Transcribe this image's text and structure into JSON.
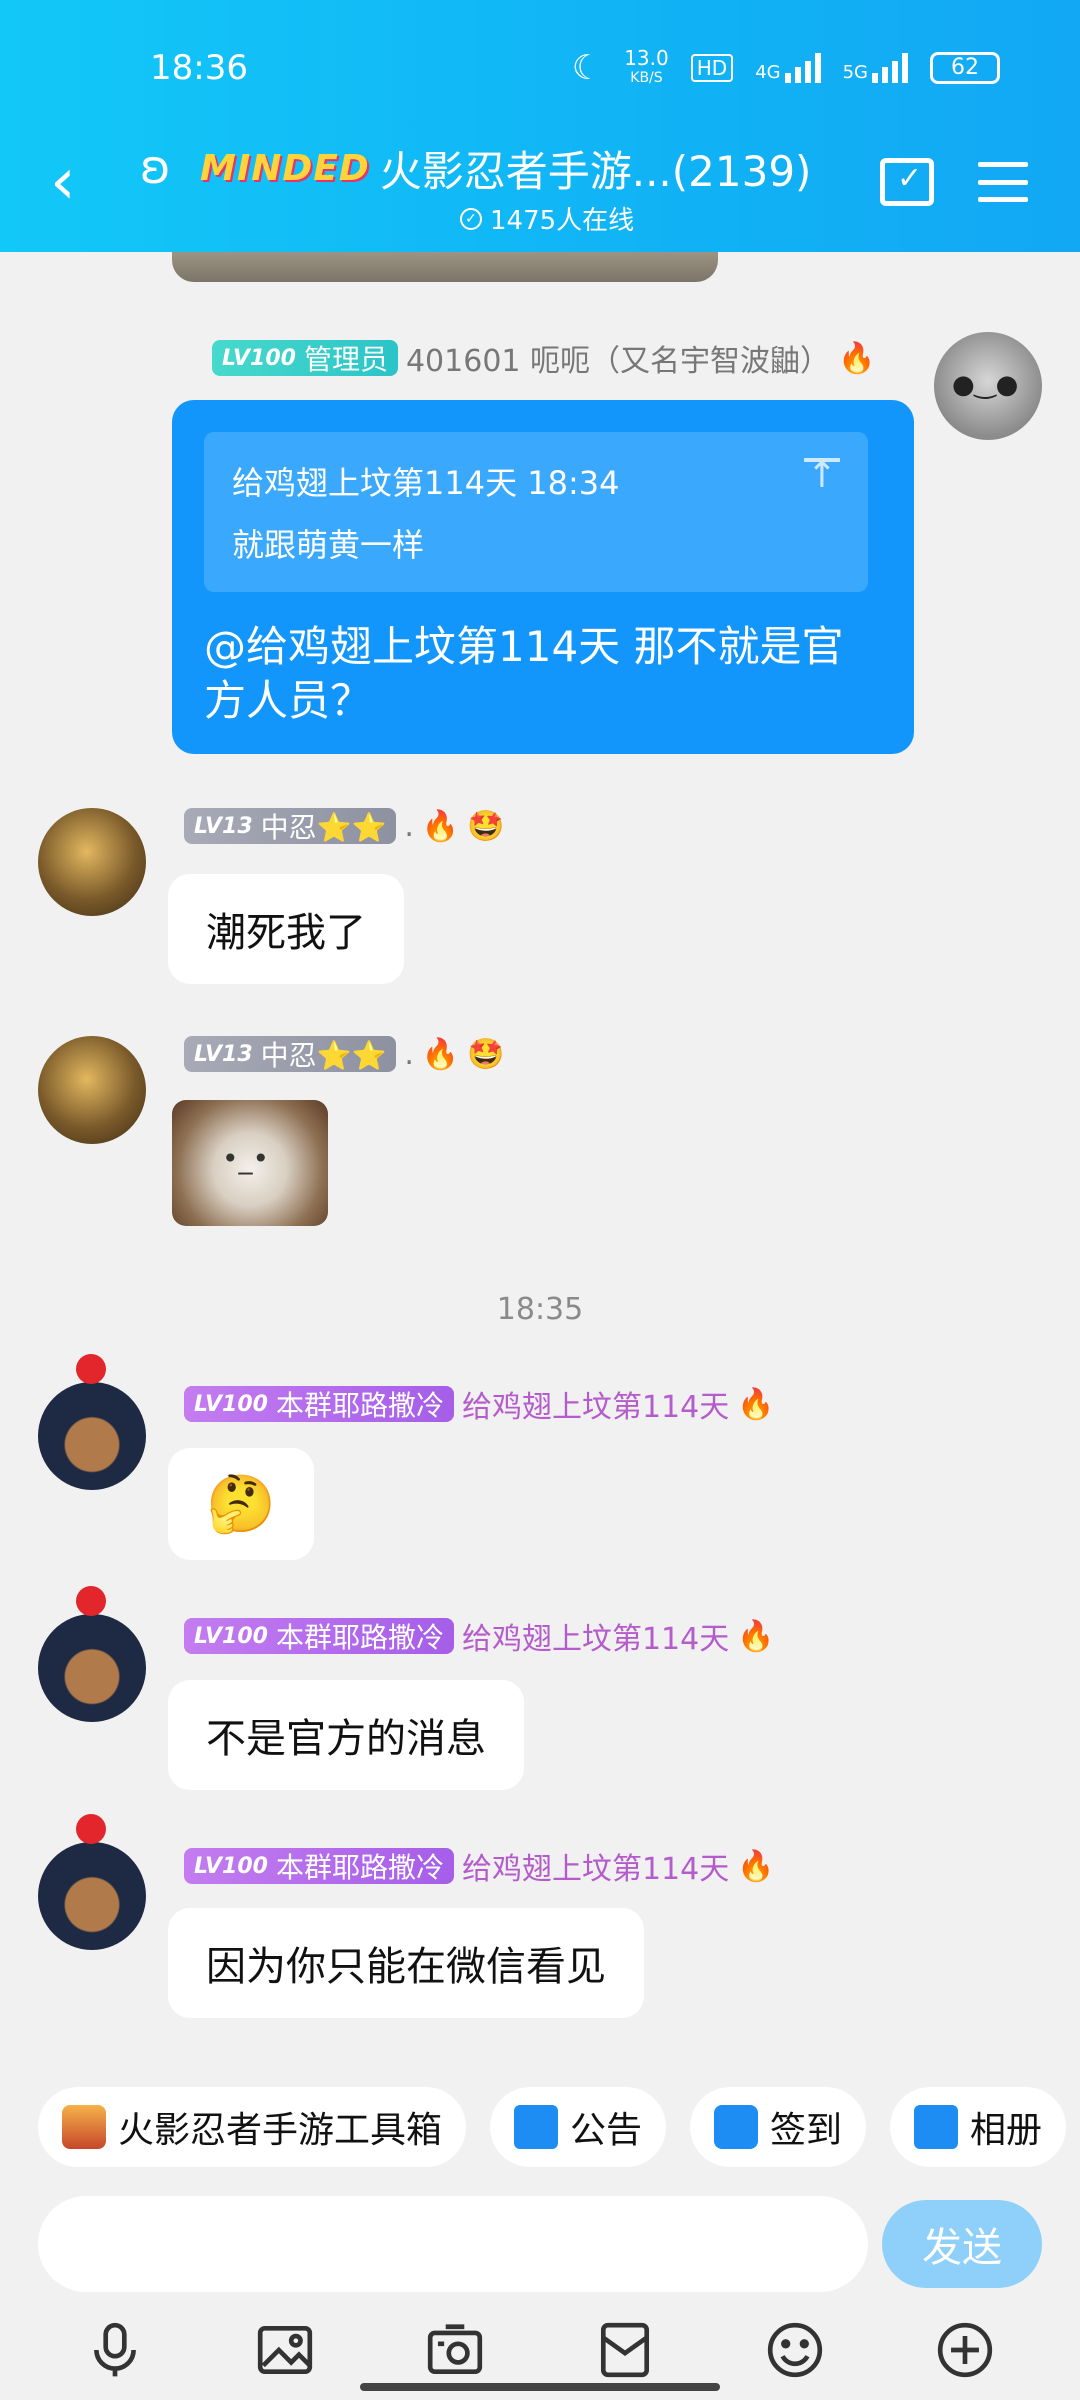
{
  "status_bar": {
    "time": "18:36",
    "speed": "13.0",
    "speed_unit": "KB/S",
    "hd": "HD",
    "net1": "4G",
    "net2": "5G",
    "battery": "62"
  },
  "header": {
    "logo_text": "MINDED",
    "title": "火影忍者手游...(2139)",
    "online": "1475人在线"
  },
  "messages": [
    {
      "badge_level": "LV100",
      "badge_title": "管理员",
      "sender": "401601 呃呃（又名宇智波鼬）",
      "quote_line1": "给鸡翅上坟第114天 18:34",
      "quote_line2": "就跟萌黄一样",
      "text": "@给鸡翅上坟第114天 那不就是官方人员？"
    },
    {
      "badge_level": "LV13",
      "badge_title": "中忍⭐⭐",
      "sender": ".",
      "text": "潮死我了"
    },
    {
      "badge_level": "LV13",
      "badge_title": "中忍⭐⭐",
      "sender": "."
    },
    {
      "badge_level": "LV100",
      "badge_title": "本群耶路撒冷",
      "sender": "给鸡翅上坟第114天",
      "text": "🤔"
    },
    {
      "badge_level": "LV100",
      "badge_title": "本群耶路撒冷",
      "sender": "给鸡翅上坟第114天",
      "text": "不是官方的消息"
    },
    {
      "badge_level": "LV100",
      "badge_title": "本群耶路撒冷",
      "sender": "给鸡翅上坟第114天",
      "text": "因为你只能在微信看见"
    }
  ],
  "time_separator": "18:35",
  "emojis": {
    "fire": "🔥",
    "flower": "🤩"
  },
  "quick_bar": [
    {
      "label": "火影忍者手游工具箱"
    },
    {
      "label": "公告"
    },
    {
      "label": "签到"
    },
    {
      "label": "相册"
    }
  ],
  "input": {
    "value": "",
    "placeholder": ""
  },
  "send_label": "发送",
  "colors": {
    "header": "#12b8f6",
    "bubble_blue": "#1296fb",
    "send_button": "#8fd0fb",
    "badge_admin": "#2bc4c7",
    "badge_zhongren": "#9b9dab",
    "badge_jerusalem": "#b36aec",
    "sender_purple": "#b55ccc"
  }
}
